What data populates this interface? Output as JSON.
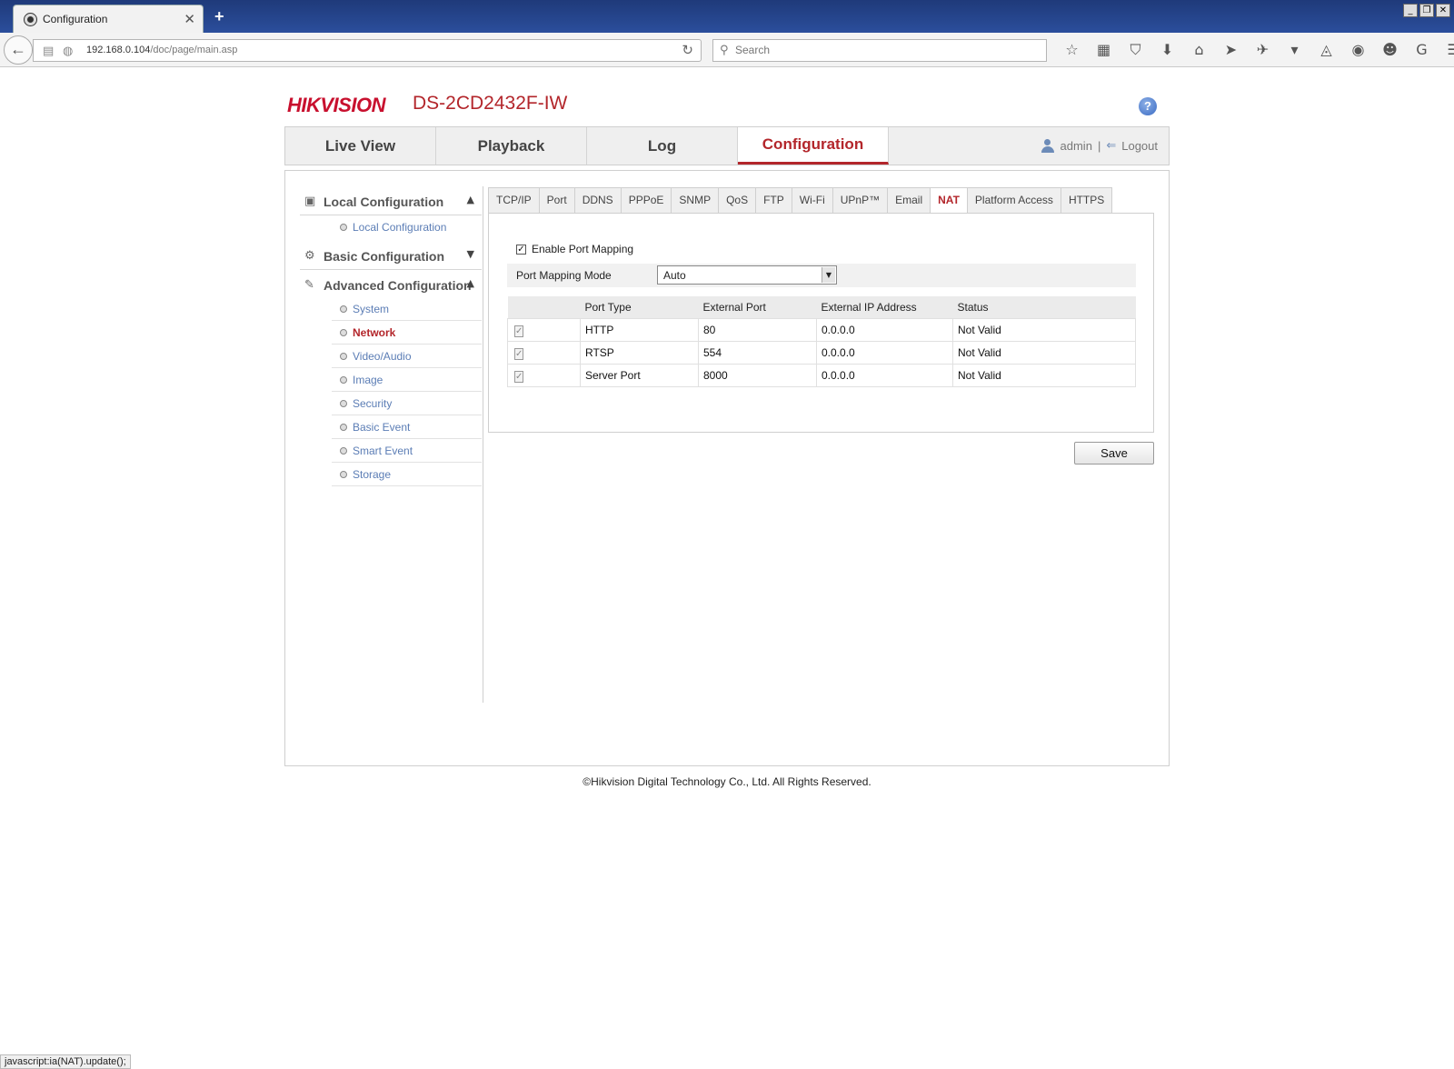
{
  "browser": {
    "tab_title": "Configuration",
    "new_tab": "+",
    "url_host": "192.168.0.104",
    "url_path": "/doc/page/main.asp",
    "search_placeholder": "Search",
    "status_text": "javascript:ia(NAT).update();"
  },
  "header": {
    "brand": "HIKVISION",
    "model": "DS-2CD2432F-IW",
    "help": "?"
  },
  "main_tabs": [
    {
      "label": "Live View"
    },
    {
      "label": "Playback"
    },
    {
      "label": "Log"
    },
    {
      "label": "Configuration",
      "active": true
    }
  ],
  "user": {
    "name": "admin",
    "separator": "|",
    "logout": "Logout"
  },
  "sidebar": {
    "local": {
      "title": "Local Configuration",
      "items": [
        "Local Configuration"
      ]
    },
    "basic": {
      "title": "Basic Configuration"
    },
    "advanced": {
      "title": "Advanced Configuration",
      "items": [
        "System",
        "Network",
        "Video/Audio",
        "Image",
        "Security",
        "Basic Event",
        "Smart Event",
        "Storage"
      ],
      "active": "Network"
    }
  },
  "sub_tabs": [
    "TCP/IP",
    "Port",
    "DDNS",
    "PPPoE",
    "SNMP",
    "QoS",
    "FTP",
    "Wi-Fi",
    "UPnP™",
    "Email",
    "NAT",
    "Platform Access",
    "HTTPS"
  ],
  "active_sub_tab": "NAT",
  "nat": {
    "enable_label": "Enable Port Mapping",
    "enable_checked": true,
    "mode_label": "Port Mapping Mode",
    "mode_value": "Auto",
    "columns": [
      "",
      "Port Type",
      "External Port",
      "External IP Address",
      "Status"
    ],
    "rows": [
      {
        "type": "HTTP",
        "port": "80",
        "ip": "0.0.0.0",
        "status": "Not Valid"
      },
      {
        "type": "RTSP",
        "port": "554",
        "ip": "0.0.0.0",
        "status": "Not Valid"
      },
      {
        "type": "Server Port",
        "port": "8000",
        "ip": "0.0.0.0",
        "status": "Not Valid"
      }
    ],
    "save_label": "Save"
  },
  "footer": "©Hikvision Digital Technology Co., Ltd. All Rights Reserved.",
  "colors": {
    "accent": "#b3262b",
    "link": "#5b7db5",
    "brand": "#c8102e"
  }
}
